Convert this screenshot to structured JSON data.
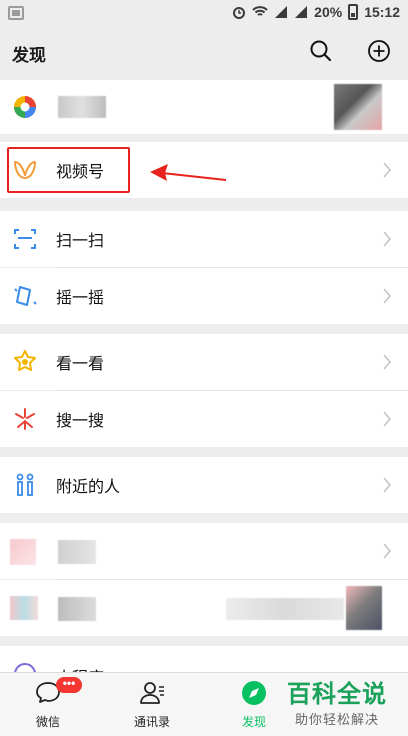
{
  "status_bar": {
    "battery": "20%",
    "time": "15:12"
  },
  "header": {
    "title": "发现"
  },
  "rows": {
    "moments": {
      "label": ""
    },
    "channels": {
      "label": "视频号"
    },
    "scan": {
      "label": "扫一扫"
    },
    "shake": {
      "label": "摇一摇"
    },
    "top_stories": {
      "label": "看一看"
    },
    "search": {
      "label": "搜一搜"
    },
    "people_nearby": {
      "label": "附近的人"
    },
    "mini_programs": {
      "label": "小程序"
    }
  },
  "tabbar": {
    "chats": {
      "label": "微信",
      "badge": "•••"
    },
    "contacts": {
      "label": "通讯录"
    },
    "discover": {
      "label": "发现"
    }
  },
  "watermark": {
    "main": "百科全说",
    "sub": "助你轻松解决"
  },
  "colors": {
    "accent": "#07c160",
    "highlight": "#e8231d",
    "badge": "#f43530"
  }
}
